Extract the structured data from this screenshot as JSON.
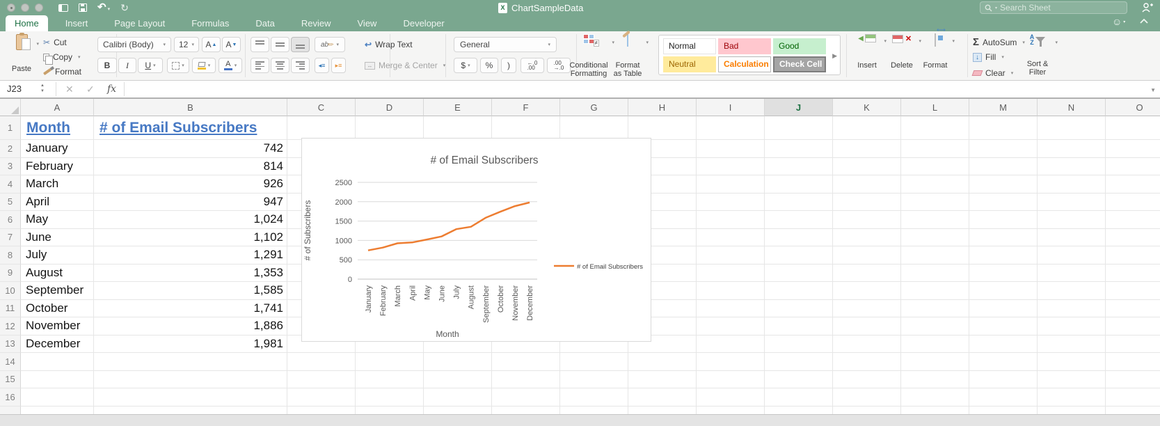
{
  "titlebar": {
    "title": "ChartSampleData",
    "search_placeholder": "Search Sheet"
  },
  "tabs": {
    "items": [
      "Home",
      "Insert",
      "Page Layout",
      "Formulas",
      "Data",
      "Review",
      "View",
      "Developer"
    ],
    "active": "Home"
  },
  "ribbon": {
    "clipboard": {
      "paste": "Paste",
      "cut": "Cut",
      "copy": "Copy",
      "format": "Format"
    },
    "font": {
      "name": "Calibri (Body)",
      "size": "12",
      "bold": "B",
      "italic": "I",
      "underline": "U"
    },
    "alignment": {
      "wrap_text": "Wrap Text",
      "merge_center": "Merge & Center"
    },
    "number": {
      "format": "General",
      "currency": "$",
      "percent": "%",
      "comma": ")",
      "increase_decimal": "←.0\n.00",
      "decrease_decimal": ".00\n→.0"
    },
    "styles": {
      "conditional_formatting_1": "Conditional",
      "conditional_formatting_2": "Formatting",
      "format_as_table_1": "Format",
      "format_as_table_2": "as Table",
      "gallery": [
        "Normal",
        "Bad",
        "Good",
        "Neutral",
        "Calculation",
        "Check Cell"
      ]
    },
    "cells": {
      "insert": "Insert",
      "delete": "Delete",
      "format": "Format"
    },
    "editing": {
      "autosum": "AutoSum",
      "fill": "Fill",
      "clear": "Clear",
      "sort_filter_1": "Sort &",
      "sort_filter_2": "Filter"
    }
  },
  "formula_bar": {
    "name_box": "J23",
    "fx_label": "fx"
  },
  "sheet": {
    "columns": [
      "A",
      "B",
      "C",
      "D",
      "E",
      "F",
      "G",
      "H",
      "I",
      "J",
      "K",
      "L",
      "M",
      "N",
      "O"
    ],
    "selected_column": "J",
    "last_row_number": 16,
    "header_row": {
      "month": "Month",
      "subscribers": "# of Email Subscribers"
    },
    "rows": [
      [
        "January",
        "742"
      ],
      [
        "February",
        "814"
      ],
      [
        "March",
        "926"
      ],
      [
        "April",
        "947"
      ],
      [
        "May",
        "1,024"
      ],
      [
        "June",
        "1,102"
      ],
      [
        "July",
        "1,291"
      ],
      [
        "August",
        "1,353"
      ],
      [
        "September",
        "1,585"
      ],
      [
        "October",
        "1,741"
      ],
      [
        "November",
        "1,886"
      ],
      [
        "December",
        "1,981"
      ]
    ]
  },
  "chart_data": {
    "type": "line",
    "title": "# of Email Subscribers",
    "categories": [
      "January",
      "February",
      "March",
      "April",
      "May",
      "June",
      "July",
      "August",
      "September",
      "October",
      "November",
      "December"
    ],
    "values": [
      742,
      814,
      926,
      947,
      1024,
      1102,
      1291,
      1353,
      1585,
      1741,
      1886,
      1981
    ],
    "xlabel": "Month",
    "ylabel": "# of Subscribers",
    "ylim": [
      0,
      2500
    ],
    "ytick_step": 500,
    "grid": true,
    "legend": [
      "# of Email Subscribers"
    ],
    "legend_position": "right",
    "line_color": "#ED7D31",
    "text_color": "#595959"
  },
  "colors": {
    "titlebar_green": "#7aa78f",
    "accent_green": "#217346",
    "header_link_blue": "#4779c4",
    "line_orange": "#ED7D31"
  }
}
